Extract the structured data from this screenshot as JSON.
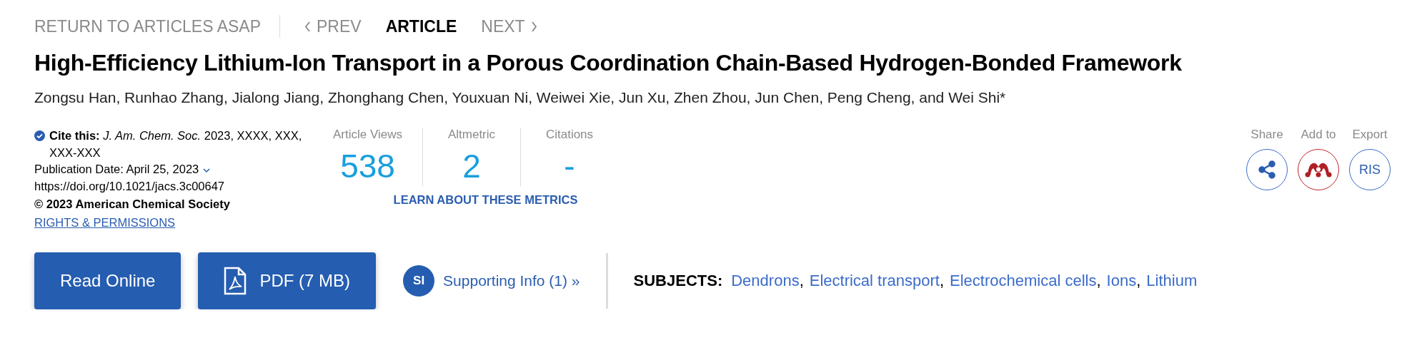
{
  "nav": {
    "return_link": "RETURN TO ARTICLES ASAP",
    "items": [
      {
        "label": "PREV",
        "kind": "prev",
        "selected": false
      },
      {
        "label": "ARTICLE",
        "kind": "current",
        "selected": true
      },
      {
        "label": "NEXT",
        "kind": "next",
        "selected": false
      }
    ]
  },
  "title": "High-Efficiency Lithium-Ion Transport in a Porous Coordination Chain-Based Hydrogen-Bonded Framework",
  "authors": "Zongsu Han, Runhao Zhang, Jialong Jiang, Zhonghang Chen, Youxuan Ni, Weiwei Xie, Jun Xu, Zhen Zhou, Jun Chen, Peng Cheng, and Wei Shi*",
  "citation": {
    "cite": "**Cite this:** *J. Am. Chem. Soc.* 2023, XXXX, XXX, XXX-XXX",
    "publication_date": "Publication Date: April 25, 2023",
    "doi": "https://doi.org/10.1021/jacs.3c00647",
    "copyright": "© 2023 American Chemical Society",
    "rights_link": "RIGHTS & PERMISSIONS"
  },
  "metrics": [
    {
      "label": "Article Views",
      "value": "538"
    },
    {
      "label": "Altmetric",
      "value": "2"
    },
    {
      "label": "Citations",
      "value": "-"
    }
  ],
  "metrics_link": "LEARN ABOUT THESE METRICS",
  "actions": [
    {
      "label": "Share",
      "kind": "share"
    },
    {
      "label": "Add to",
      "kind": "mendeley"
    },
    {
      "label": "Export",
      "kind": "ris",
      "button_text": "RIS"
    }
  ],
  "buttons": [
    {
      "label": "Read Online",
      "kind": "plain"
    },
    {
      "label": "PDF (7 MB)",
      "kind": "pdf"
    }
  ],
  "supporting_info": {
    "badge": "SI",
    "label": "Supporting Info (1) »"
  },
  "subjects": {
    "label": "SUBJECTS:",
    "items": [
      {
        "label": "Dendrons",
        "separator": ","
      },
      {
        "label": "Electrical transport",
        "separator": ","
      },
      {
        "label": "Electrochemical cells",
        "separator": ","
      },
      {
        "label": "Ions",
        "separator": ","
      },
      {
        "label": "Lithium"
      }
    ]
  }
}
